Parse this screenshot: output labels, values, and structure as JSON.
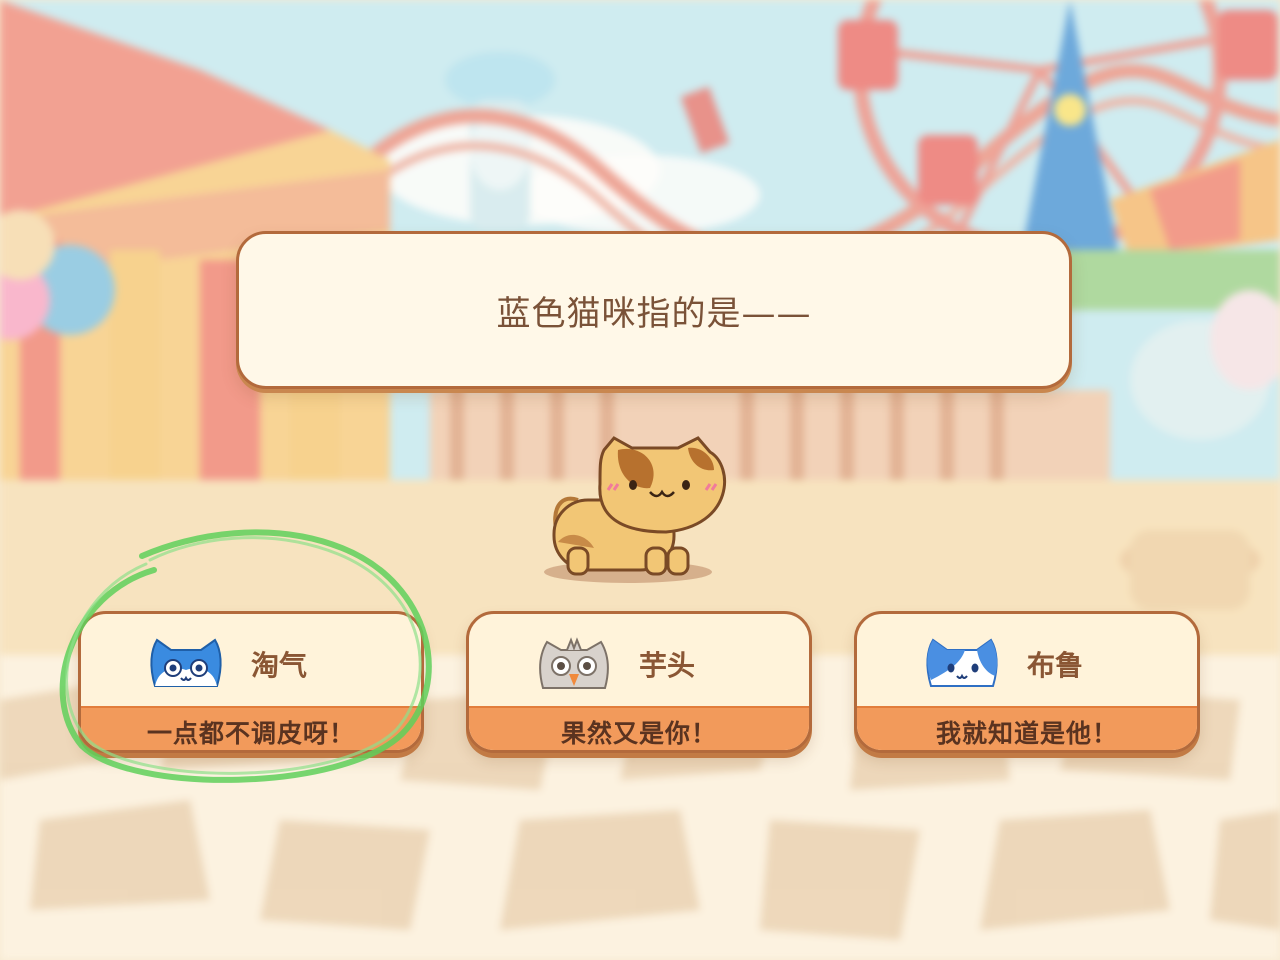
{
  "question": {
    "text": "蓝色猫咪指的是——"
  },
  "mascot": {
    "icon": "brown-cat-icon"
  },
  "answers": [
    {
      "name": "淘气",
      "caption": "一点都不调皮呀！",
      "icon": "blue-cat-face-icon",
      "highlighted": true
    },
    {
      "name": "芋头",
      "caption": "果然又是你！",
      "icon": "gray-owl-cat-face-icon",
      "highlighted": false
    },
    {
      "name": "布鲁",
      "caption": "我就知道是他！",
      "icon": "blue-white-cat-face-icon",
      "highlighted": false
    }
  ],
  "colors": {
    "card_bar": "#f29a5b",
    "card_border": "#b36a3c",
    "highlight": "#5fd05a"
  }
}
